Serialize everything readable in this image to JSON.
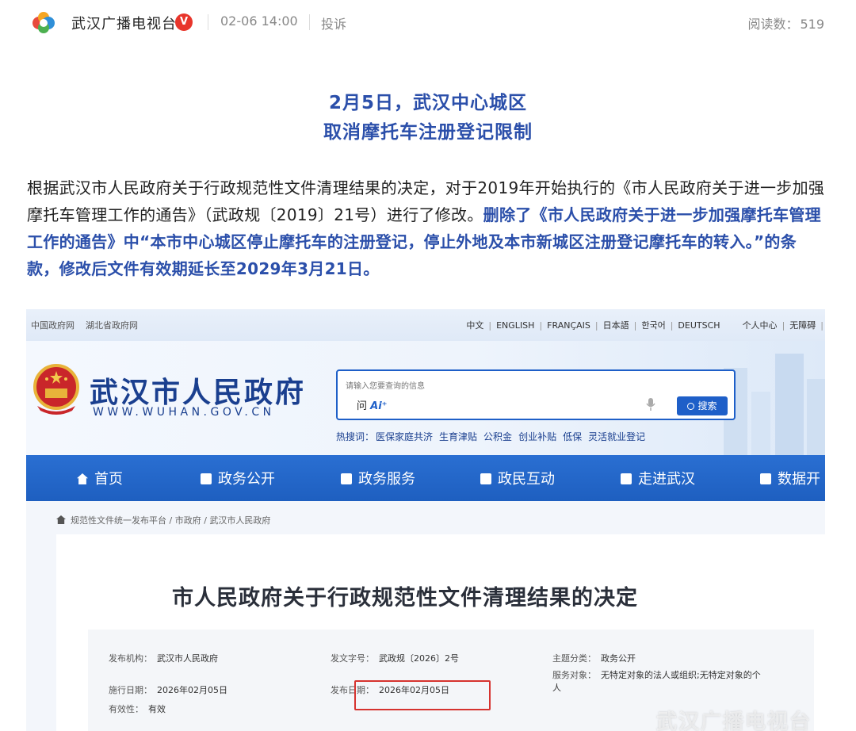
{
  "header": {
    "source_name": "武汉广播电视台",
    "verified_badge": "V",
    "timestamp": "02-06 14:00",
    "complain_label": "投诉",
    "read_label": "阅读数：",
    "read_count": "519"
  },
  "article": {
    "headline_line1": "2月5日，武汉中心城区",
    "headline_line2": "取消摩托车注册登记限制",
    "body_plain": "根据武汉市人民政府关于行政规范性文件清理结果的决定，对于2019年开始执行的《市人民政府关于进一步加强摩托车管理工作的通告》（武政规〔2019〕21号）进行了修改。",
    "body_highlight": "删除了《市人民政府关于进一步加强摩托车管理工作的通告》中“本市中心城区停止摩托车的注册登记，停止外地及本市新城区注册登记摩托车的转入。”的条款，修改后文件有效期延长至2029年3月21日。"
  },
  "screenshot": {
    "top_links_left": [
      "中国政府网",
      "湖北省政府网"
    ],
    "top_links_right": [
      "中文",
      "ENGLISH",
      "FRANÇAIS",
      "日本語",
      "한국어",
      "DEUTSCH"
    ],
    "top_links_user": [
      "个人中心",
      "无障碍"
    ],
    "site_name": "武汉市人民政府",
    "site_url": "WWW.WUHAN.GOV.CN",
    "search_placeholder": "请输入您要查询的信息",
    "search_ai_prefix": "问",
    "search_ai_label": "Ai⁺",
    "search_button": "搜索",
    "hot_label": "热搜词：",
    "hot_words": [
      "医保家庭共济",
      "生育津贴",
      "公积金",
      "创业补贴",
      "低保",
      "灵活就业登记"
    ],
    "nav": [
      "首页",
      "政务公开",
      "政务服务",
      "政民互动",
      "走进武汉",
      "数据开"
    ],
    "breadcrumb": "规范性文件统一发布平台 / 市政府 / 武汉市人民政府",
    "doc_title": "市人民政府关于行政规范性文件清理结果的决定",
    "meta": {
      "issuer_label": "发布机构：",
      "issuer": "武汉市人民政府",
      "doc_no_label": "发文字号：",
      "doc_no": "武政规〔2026〕2号",
      "topic_label": "主题分类：",
      "topic": "政务公开",
      "effective_label": "施行日期：",
      "effective": "2026年02月05日",
      "publish_label": "发布日期：",
      "publish": "2026年02月05日",
      "service_label": "服务对象：",
      "service_line1": "无特定对象的法人或组织;无特定对象的个",
      "service_line2": "人",
      "validity_label": "有效性：",
      "validity": "有效"
    },
    "watermark": "武汉广播电视台"
  },
  "colors": {
    "headline_blue": "#2b4faa",
    "nav_blue": "#1e5fc0",
    "highlight_red": "#d6332f",
    "badge_red": "#e8352b"
  }
}
